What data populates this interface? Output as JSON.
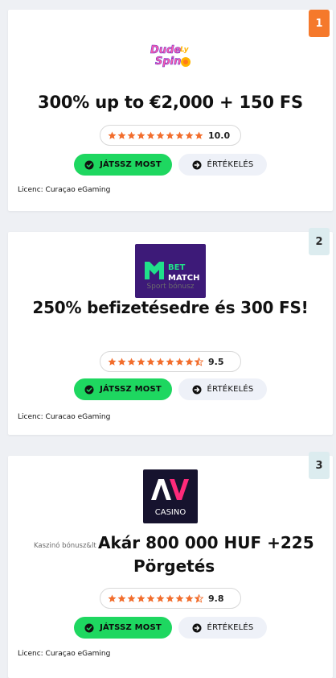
{
  "cards": [
    {
      "rank": "1",
      "logo_alt": "Dude Spin",
      "headline": "300% up to €2,000 + 150 FS",
      "score": "10.0",
      "rating": 10,
      "play_label": "JÁTSSZ MOST",
      "review_label": "ÉRTÉKELÉS",
      "licence": "Licenc: Curaçao eGaming"
    },
    {
      "rank": "2",
      "logo_alt": "Bet Match",
      "logo_text_top": "BET",
      "logo_text_bottom": "MATCH",
      "bonus_type": "Sport bónusz",
      "headline": "250% befizetésedre és 300 FS!",
      "score": "9.5",
      "rating": 9.5,
      "play_label": "JÁTSSZ MOST",
      "review_label": "ÉRTÉKELÉS",
      "licence": "Licenc: Curacao eGaming"
    },
    {
      "rank": "3",
      "logo_alt": "AV Casino",
      "logo_text": "CASINO",
      "bonus_type": "Kaszinó bónusz&lt",
      "headline_line1": "Akár 800 000 HUF +225",
      "headline_line2": "Pörgetés",
      "score": "9.8",
      "rating": 9.5,
      "play_label": "JÁTSSZ MOST",
      "review_label": "ÉRTÉKELÉS",
      "licence": "Licenc: Curaçao eGaming"
    }
  ],
  "colors": {
    "accent_orange": "#f5792b",
    "play_green": "#1ed760",
    "star_orange": "#f26d2c",
    "review_bg": "#eef1f8",
    "rank_other_bg": "#dcecef"
  }
}
